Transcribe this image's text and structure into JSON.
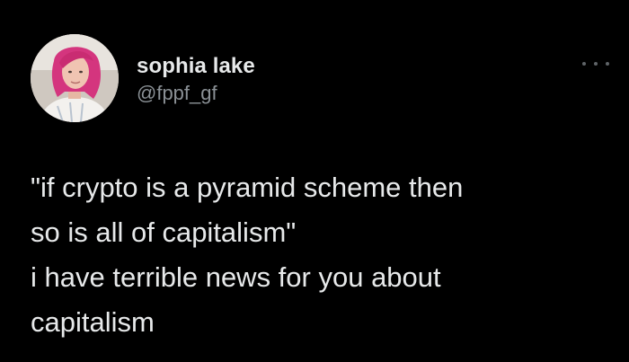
{
  "tweet": {
    "author": {
      "display_name": "sophia lake",
      "handle": "@fppf_gf",
      "avatar_icon": "user-avatar"
    },
    "more_icon": "more-options-icon",
    "lines": [
      "\"if crypto is a pyramid scheme then",
      "so is all of capitalism\"",
      "i have terrible news for you about",
      "capitalism"
    ]
  },
  "colors": {
    "background": "#000000",
    "text": "#e7e9ea",
    "handle": "#8b9196",
    "hair": "#d4357e"
  }
}
